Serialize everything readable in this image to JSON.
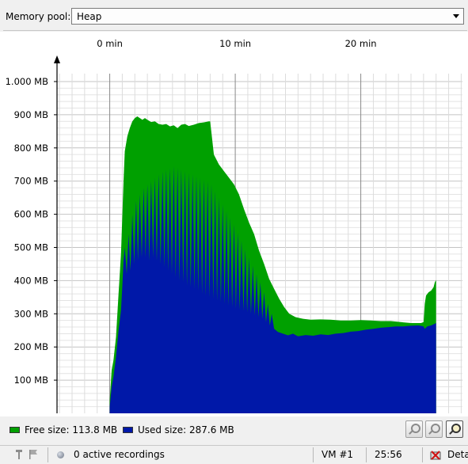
{
  "memory_pool": {
    "label": "Memory pool:",
    "selected": "Heap"
  },
  "chart_data": {
    "type": "area",
    "xlabel": "",
    "ylabel": "",
    "x_unit": "min",
    "xlim": [
      -4.2,
      28.1
    ],
    "ylim": [
      0,
      1000
    ],
    "x_ticks": [
      {
        "value": 0,
        "label": "0 min"
      },
      {
        "value": 10,
        "label": "10 min"
      },
      {
        "value": 20,
        "label": "20 min"
      }
    ],
    "y_ticks": [
      {
        "value": 100,
        "label": "100 MB"
      },
      {
        "value": 200,
        "label": "200 MB"
      },
      {
        "value": 300,
        "label": "300 MB"
      },
      {
        "value": 400,
        "label": "400 MB"
      },
      {
        "value": 500,
        "label": "500 MB"
      },
      {
        "value": 600,
        "label": "600 MB"
      },
      {
        "value": 700,
        "label": "700 MB"
      },
      {
        "value": 800,
        "label": "800 MB"
      },
      {
        "value": 900,
        "label": "900 MB"
      },
      {
        "value": 1000,
        "label": "1.000 MB"
      }
    ],
    "grid": true,
    "series": [
      {
        "name": "Free size",
        "stacked_top": true,
        "color": "#00a000",
        "points": [
          [
            0.0,
            40
          ],
          [
            0.15,
            130
          ],
          [
            0.3,
            160
          ],
          [
            0.5,
            230
          ],
          [
            0.7,
            360
          ],
          [
            0.9,
            480
          ],
          [
            1.1,
            700
          ],
          [
            1.2,
            790
          ],
          [
            1.4,
            835
          ],
          [
            1.6,
            860
          ],
          [
            1.8,
            880
          ],
          [
            2.0,
            890
          ],
          [
            2.2,
            895
          ],
          [
            2.4,
            890
          ],
          [
            2.6,
            885
          ],
          [
            2.8,
            890
          ],
          [
            3.0,
            885
          ],
          [
            3.3,
            878
          ],
          [
            3.6,
            880
          ],
          [
            3.9,
            872
          ],
          [
            4.2,
            870
          ],
          [
            4.5,
            872
          ],
          [
            4.8,
            865
          ],
          [
            5.1,
            868
          ],
          [
            5.4,
            860
          ],
          [
            5.7,
            870
          ],
          [
            6.0,
            872
          ],
          [
            6.3,
            866
          ],
          [
            6.7,
            870
          ],
          [
            7.1,
            875
          ],
          [
            7.5,
            877
          ],
          [
            7.9,
            880
          ],
          [
            8.0,
            880
          ],
          [
            8.3,
            780
          ],
          [
            8.7,
            750
          ],
          [
            9.1,
            730
          ],
          [
            9.5,
            710
          ],
          [
            9.9,
            690
          ],
          [
            10.3,
            660
          ],
          [
            10.7,
            615
          ],
          [
            11.1,
            575
          ],
          [
            11.5,
            540
          ],
          [
            11.9,
            490
          ],
          [
            12.3,
            450
          ],
          [
            12.7,
            405
          ],
          [
            13.1,
            375
          ],
          [
            13.5,
            345
          ],
          [
            13.9,
            320
          ],
          [
            14.3,
            300
          ],
          [
            14.8,
            290
          ],
          [
            15.4,
            285
          ],
          [
            16.0,
            282
          ],
          [
            16.8,
            283
          ],
          [
            17.6,
            282
          ],
          [
            18.4,
            280
          ],
          [
            19.2,
            280
          ],
          [
            20.0,
            281
          ],
          [
            20.8,
            280
          ],
          [
            21.6,
            278
          ],
          [
            22.4,
            278
          ],
          [
            23.2,
            275
          ],
          [
            24.0,
            272
          ],
          [
            24.8,
            272
          ],
          [
            25.0,
            275
          ],
          [
            25.1,
            330
          ],
          [
            25.2,
            355
          ],
          [
            25.4,
            365
          ],
          [
            25.6,
            370
          ],
          [
            25.8,
            380
          ],
          [
            25.9,
            395
          ],
          [
            26.0,
            402
          ],
          [
            26.0,
            0
          ]
        ]
      },
      {
        "name": "Used size",
        "color": "#0018a8",
        "points": [
          [
            0.0,
            20
          ],
          [
            0.15,
            80
          ],
          [
            0.3,
            110
          ],
          [
            0.5,
            170
          ],
          [
            0.7,
            250
          ],
          [
            0.9,
            310
          ],
          [
            1.0,
            380
          ],
          [
            1.1,
            460
          ],
          [
            1.2,
            500
          ],
          [
            1.35,
            420
          ],
          [
            1.5,
            540
          ],
          [
            1.65,
            430
          ],
          [
            1.8,
            600
          ],
          [
            1.95,
            450
          ],
          [
            2.1,
            640
          ],
          [
            2.25,
            460
          ],
          [
            2.4,
            660
          ],
          [
            2.55,
            470
          ],
          [
            2.7,
            680
          ],
          [
            2.85,
            470
          ],
          [
            3.0,
            690
          ],
          [
            3.15,
            460
          ],
          [
            3.3,
            700
          ],
          [
            3.45,
            470
          ],
          [
            3.6,
            710
          ],
          [
            3.75,
            460
          ],
          [
            3.9,
            720
          ],
          [
            4.05,
            450
          ],
          [
            4.2,
            730
          ],
          [
            4.35,
            440
          ],
          [
            4.5,
            735
          ],
          [
            4.65,
            430
          ],
          [
            4.8,
            740
          ],
          [
            4.95,
            420
          ],
          [
            5.1,
            745
          ],
          [
            5.25,
            410
          ],
          [
            5.4,
            740
          ],
          [
            5.55,
            400
          ],
          [
            5.7,
            735
          ],
          [
            5.85,
            395
          ],
          [
            6.0,
            730
          ],
          [
            6.15,
            385
          ],
          [
            6.3,
            725
          ],
          [
            6.45,
            380
          ],
          [
            6.6,
            720
          ],
          [
            6.75,
            375
          ],
          [
            6.9,
            715
          ],
          [
            7.05,
            370
          ],
          [
            7.2,
            710
          ],
          [
            7.35,
            360
          ],
          [
            7.5,
            705
          ],
          [
            7.65,
            355
          ],
          [
            7.8,
            700
          ],
          [
            7.95,
            350
          ],
          [
            8.1,
            690
          ],
          [
            8.25,
            345
          ],
          [
            8.4,
            670
          ],
          [
            8.55,
            340
          ],
          [
            8.7,
            650
          ],
          [
            8.85,
            335
          ],
          [
            9.0,
            630
          ],
          [
            9.15,
            330
          ],
          [
            9.3,
            610
          ],
          [
            9.45,
            325
          ],
          [
            9.6,
            590
          ],
          [
            9.75,
            320
          ],
          [
            9.9,
            570
          ],
          [
            10.05,
            315
          ],
          [
            10.2,
            545
          ],
          [
            10.35,
            312
          ],
          [
            10.5,
            520
          ],
          [
            10.65,
            308
          ],
          [
            10.8,
            495
          ],
          [
            10.95,
            305
          ],
          [
            11.1,
            470
          ],
          [
            11.25,
            300
          ],
          [
            11.4,
            445
          ],
          [
            11.55,
            295
          ],
          [
            11.7,
            420
          ],
          [
            11.85,
            290
          ],
          [
            12.0,
            395
          ],
          [
            12.15,
            285
          ],
          [
            12.3,
            365
          ],
          [
            12.45,
            275
          ],
          [
            12.6,
            330
          ],
          [
            12.75,
            265
          ],
          [
            12.9,
            300
          ],
          [
            13.1,
            255
          ],
          [
            13.4,
            245
          ],
          [
            13.8,
            240
          ],
          [
            14.2,
            235
          ],
          [
            14.6,
            240
          ],
          [
            15.0,
            232
          ],
          [
            15.6,
            236
          ],
          [
            16.2,
            234
          ],
          [
            16.8,
            238
          ],
          [
            17.4,
            236
          ],
          [
            18.0,
            240
          ],
          [
            18.6,
            242
          ],
          [
            19.2,
            246
          ],
          [
            19.8,
            248
          ],
          [
            20.4,
            252
          ],
          [
            21.0,
            255
          ],
          [
            21.6,
            258
          ],
          [
            22.2,
            260
          ],
          [
            22.8,
            262
          ],
          [
            23.4,
            262
          ],
          [
            24.0,
            264
          ],
          [
            24.6,
            265
          ],
          [
            25.0,
            262
          ],
          [
            25.1,
            255
          ],
          [
            25.3,
            262
          ],
          [
            25.6,
            265
          ],
          [
            25.9,
            270
          ],
          [
            26.0,
            272
          ],
          [
            26.0,
            0
          ]
        ]
      }
    ]
  },
  "legend": {
    "free_label": "Free size: 113.8 MB",
    "used_label": "Used size: 287.6 MB",
    "free_color": "#00a000",
    "used_color": "#0018a8"
  },
  "toolbar_icons": [
    "zoom-in-icon",
    "zoom-out-icon",
    "zoom-reset-icon"
  ],
  "status": {
    "recordings": "0 active recordings",
    "vm": "VM #1",
    "time": "25:56",
    "detach": "Deta"
  }
}
